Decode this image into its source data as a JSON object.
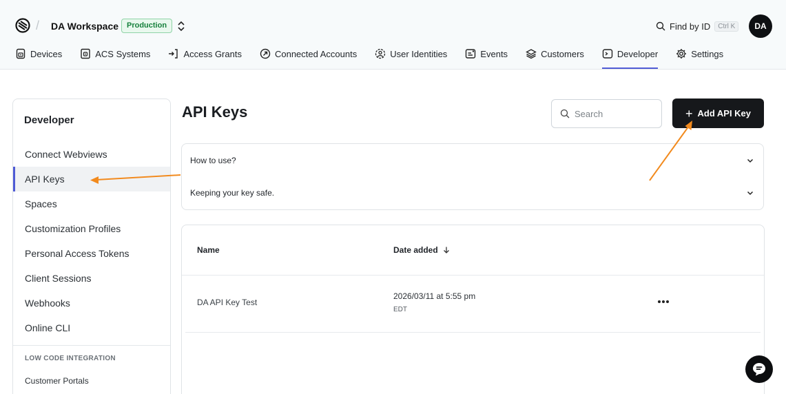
{
  "header": {
    "logo_icon": "seam-logo-icon",
    "workspace_name": "DA Workspace",
    "environment_badge": "Production",
    "switcher_icon": "chevron-up-down-icon",
    "find_by_id": {
      "label": "Find by ID",
      "shortcut": "Ctrl K",
      "icon": "search-icon"
    },
    "avatar_initials": "DA"
  },
  "nav": {
    "items": [
      {
        "label": "Devices",
        "icon": "device-icon",
        "active": false
      },
      {
        "label": "ACS Systems",
        "icon": "access-panel-icon",
        "active": false
      },
      {
        "label": "Access Grants",
        "icon": "key-grant-icon",
        "active": false
      },
      {
        "label": "Connected Accounts",
        "icon": "link-icon",
        "active": false
      },
      {
        "label": "User Identities",
        "icon": "user-identity-icon",
        "active": false
      },
      {
        "label": "Events",
        "icon": "events-icon",
        "active": false
      },
      {
        "label": "Customers",
        "icon": "layers-icon",
        "active": false
      },
      {
        "label": "Developer",
        "icon": "terminal-icon",
        "active": true
      },
      {
        "label": "Settings",
        "icon": "gear-icon",
        "active": false
      }
    ],
    "accent_color": "#4f5bd5"
  },
  "sidebar": {
    "title": "Developer",
    "items": [
      {
        "label": "Connect Webviews",
        "active": false
      },
      {
        "label": "API Keys",
        "active": true
      },
      {
        "label": "Spaces",
        "active": false
      },
      {
        "label": "Customization Profiles",
        "active": false
      },
      {
        "label": "Personal Access Tokens",
        "active": false
      },
      {
        "label": "Client Sessions",
        "active": false
      },
      {
        "label": "Webhooks",
        "active": false
      },
      {
        "label": "Online CLI",
        "active": false
      }
    ],
    "section_label": "LOW CODE INTEGRATION",
    "section_items": [
      {
        "label": "Customer Portals"
      }
    ]
  },
  "main": {
    "title": "API Keys",
    "search": {
      "placeholder": "Search",
      "value": ""
    },
    "add_button_label": "Add API Key",
    "accordion": [
      {
        "label": "How to use?",
        "icon": "chevron-down-icon"
      },
      {
        "label": "Keeping your key safe.",
        "icon": "chevron-down-icon"
      }
    ],
    "table": {
      "columns": [
        {
          "label": "Name"
        },
        {
          "label": "Date added",
          "sort_icon": "arrow-down-icon"
        }
      ],
      "rows": [
        {
          "name": "DA API Key Test",
          "date": "2026/03/11 at 5:55 pm",
          "timezone": "EDT",
          "actions_icon": "more-horizontal-icon"
        }
      ]
    }
  },
  "chat_widget_icon": "chat-bubble-icon",
  "annotation_color": "#f28a1d"
}
